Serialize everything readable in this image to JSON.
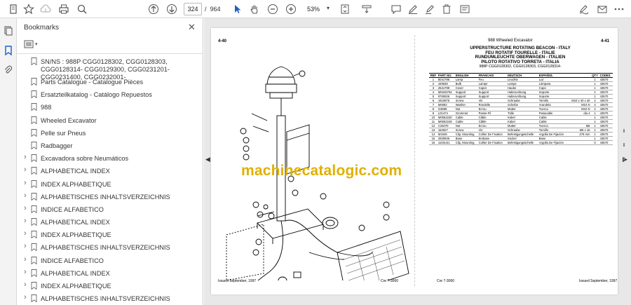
{
  "toolbar": {
    "current_page": "324",
    "page_separator": "/",
    "total_pages": "964",
    "zoom": "53%"
  },
  "panel": {
    "title": "Bookmarks"
  },
  "bookmarks": [
    {
      "label": "SN/NS : 988P CGG0128302, CGG0128303, CGG0128314- CGG0129300, CGG0231201-CGG0231400, CGG0232001-",
      "expandable": false
    },
    {
      "label": "Parts Catalogue - Catalogue Pièces",
      "expandable": false
    },
    {
      "label": "Ersatzteilkatalog - Catálogo Repuestos",
      "expandable": false
    },
    {
      "label": "988",
      "expandable": false
    },
    {
      "label": "Wheeled Excavator",
      "expandable": false
    },
    {
      "label": "Pelle sur Pneus",
      "expandable": false
    },
    {
      "label": "Radbagger",
      "expandable": false
    },
    {
      "label": "Excavadora sobre Neumáticos",
      "expandable": true
    },
    {
      "label": "ALPHABETICAL INDEX",
      "expandable": true
    },
    {
      "label": "INDEX ALPHABETIQUE",
      "expandable": true
    },
    {
      "label": "ALPHABETISCHES INHALTSVERZEICHNIS",
      "expandable": true
    },
    {
      "label": "INDICE ALFABETICO",
      "expandable": true
    },
    {
      "label": "ALPHABETICAL INDEX",
      "expandable": true
    },
    {
      "label": "INDEX ALPHABETIQUE",
      "expandable": true
    },
    {
      "label": "ALPHABETISCHES INHALTSVERZEICHNIS",
      "expandable": true
    },
    {
      "label": "INDICE ALFABETICO",
      "expandable": true
    },
    {
      "label": "ALPHABETICAL INDEX",
      "expandable": true
    },
    {
      "label": "INDEX ALPHABETIQUE",
      "expandable": true
    },
    {
      "label": "ALPHABETISCHES INHALTSVERZEICHNIS",
      "expandable": true
    }
  ],
  "document": {
    "left_page_num": "4-40",
    "right_page_num": "4-41",
    "model_header": "988 Wheeled Excavator",
    "title_lines": [
      "UPPERSTRUCTURE ROTATING BEACON - ITALY",
      "FEU ROTATIF TOURELLE - ITALIE",
      "RUNDUMLEUCHTE OBERWAGEN - ITALIEN",
      "PILOTO ROTATIVO TORRETA - ITALIA"
    ],
    "serial_line": "988P CGG0128302, CGG0128303, CGG0128314-",
    "watermark": "machinecatalogic.com",
    "footer_issued_left": "Issued September, 1997",
    "footer_code_left": "Cre 7-3060",
    "footer_code_right": "Cre 7-3060",
    "footer_issued_right": "Issued September, 1997",
    "drawing_code": "10ft7u36",
    "table_headers": [
      "REF",
      "PART NO.",
      "ENGLISH",
      "FRANCAIS",
      "DEUTSCH",
      "ESPAÑOL",
      "",
      "QTY",
      "CODES"
    ],
    "table_rows": [
      [
        "1",
        "8041796",
        "Lamp",
        "Feu",
        "Leuchte",
        "Luz",
        "",
        "1",
        "43570"
      ],
      [
        "2",
        "449530",
        "Bulb",
        "Lampe",
        "Lampe",
        "Lámpara",
        "",
        "1",
        "43570"
      ],
      [
        "3",
        "2541799",
        "Cover",
        "Capot",
        "Haube",
        "Capo",
        "",
        "1",
        "43570"
      ],
      [
        "4",
        "M0345794",
        "Support",
        "Support",
        "Halterunhtung",
        "Soporte",
        "",
        "1",
        "43570"
      ],
      [
        "5",
        "9760926",
        "Support",
        "Support",
        "Halterunhtung",
        "Soporte",
        "",
        "1",
        "43570"
      ],
      [
        "6",
        "1910876",
        "Screw",
        "Vis",
        "Schraube",
        "Tornillo",
        "M10 x 40 x 40",
        "2",
        "43570"
      ],
      [
        "7",
        "M0082",
        "Washer",
        "Rondelle",
        "Scheibe",
        "Arandela",
        "M10 N",
        "4",
        "43570"
      ],
      [
        "8",
        "G3698",
        "Nut",
        "Ecrou",
        "Mutter",
        "Tuerca",
        "M10 N",
        "2",
        "43570"
      ],
      [
        "9",
        "L01474",
        "Grommet",
        "Passe-Fil",
        "Tülle",
        "Pasacable",
        "dia 4",
        "1",
        "43570"
      ],
      [
        "10",
        "M0062230",
        "Cable",
        "Câble",
        "Kabel",
        "Cable",
        "",
        "1",
        "43570"
      ],
      [
        "11",
        "M0062249",
        "Cable",
        "Câble",
        "Kabel",
        "Cable",
        "",
        "1",
        "43570"
      ],
      [
        "12",
        "C34070",
        "Nut",
        "Ecrou",
        "Mutter",
        "Tuerca",
        "M6",
        "1",
        "43570"
      ],
      [
        "13",
        "152527",
        "Screw",
        "Vis",
        "Schraube",
        "Tornillo",
        "M6 x 16",
        "1",
        "43570"
      ],
      [
        "14",
        "M1946",
        "Clip, Mounting",
        "Collier De Fixation",
        "Befestigungsschelle",
        "Argolla De Fijación",
        "275 mm",
        "1",
        "43570"
      ],
      [
        "15",
        "2930926",
        "Base",
        "Embase",
        "Sockel",
        "Base",
        "",
        "1",
        "43570"
      ],
      [
        "16",
        "1103U41",
        "Clip, Mounting",
        "Collier De Fixation",
        "Befestigungsschelle",
        "Argolla De Fijación",
        "",
        "0",
        "43570"
      ]
    ]
  }
}
